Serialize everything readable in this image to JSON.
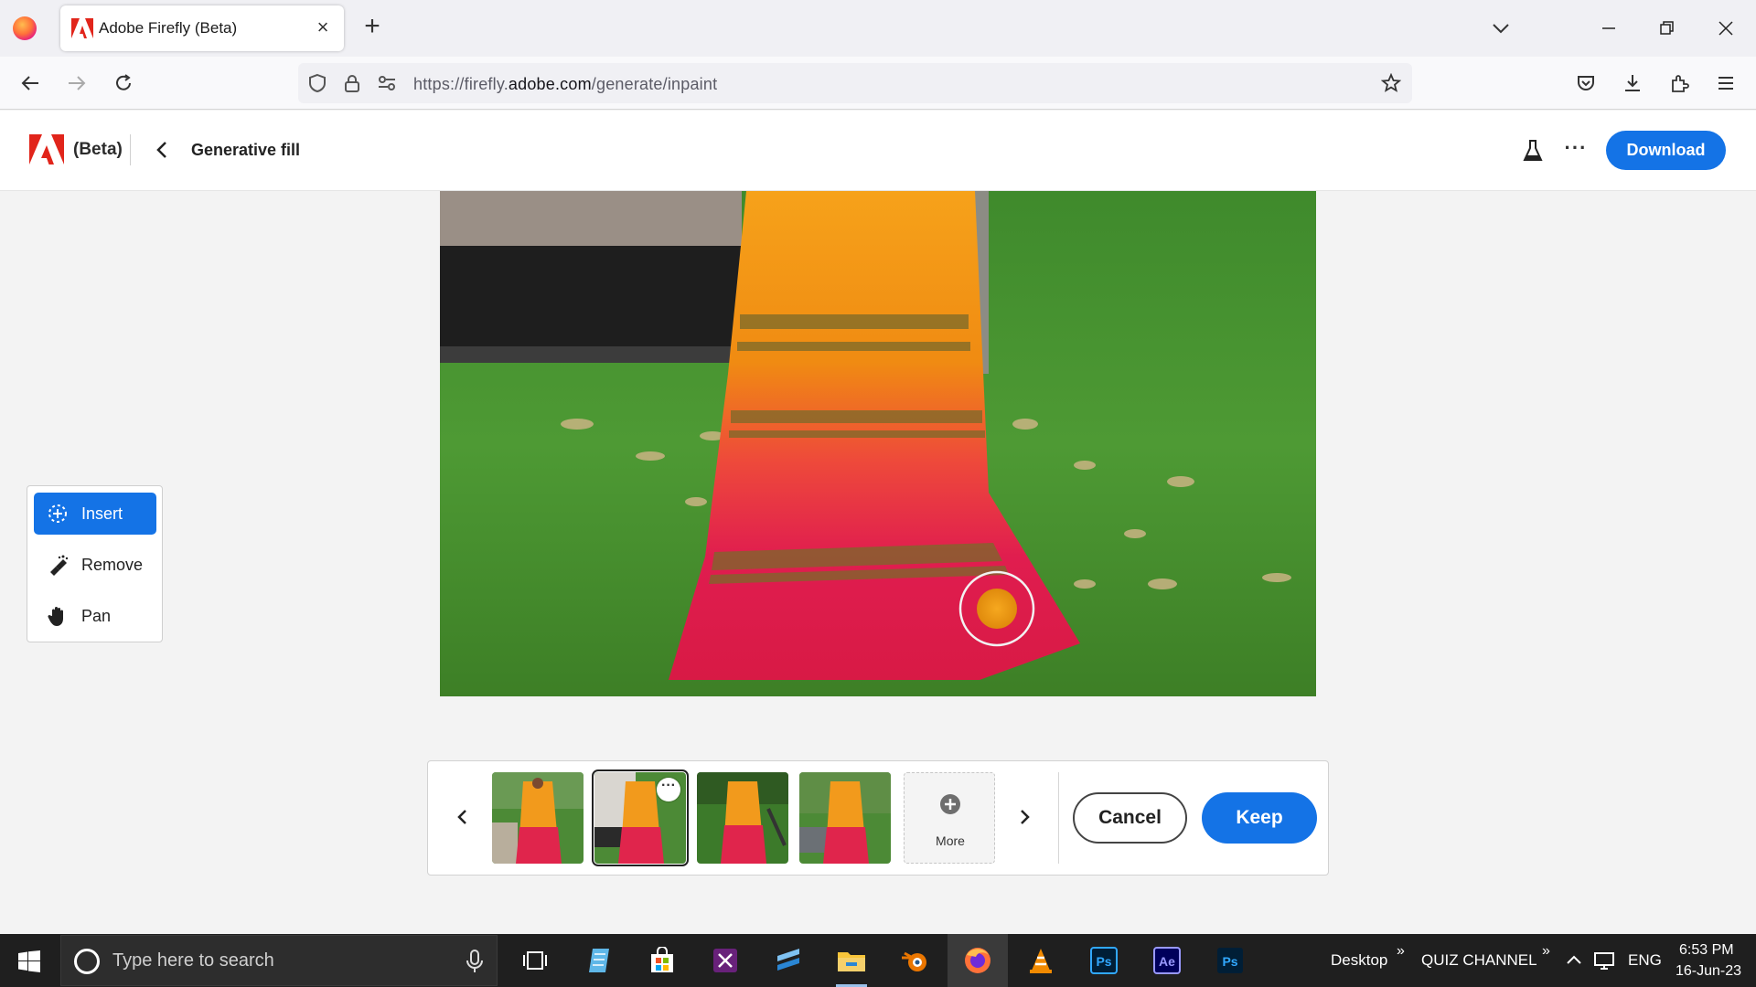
{
  "browser": {
    "tab_title": "Adobe Firefly (Beta)",
    "tab_close": "×",
    "new_tab": "+",
    "url_prefix": "https://firefly.",
    "url_domain": "adobe.com",
    "url_path": "/generate/inpaint"
  },
  "app": {
    "beta_label": "(Beta)",
    "page_title": "Generative fill",
    "more_label": "···",
    "download_label": "Download",
    "accent": "#1473e6"
  },
  "tools": [
    {
      "label": "Insert",
      "icon": "insert-sparkle-icon",
      "active": true
    },
    {
      "label": "Remove",
      "icon": "remove-eraser-icon",
      "active": false
    },
    {
      "label": "Pan",
      "icon": "hand-icon",
      "active": false
    }
  ],
  "variations": {
    "thumbnails": 4,
    "selected_index": 2,
    "thumb_menu": "···",
    "more_label": "More",
    "cancel_label": "Cancel",
    "keep_label": "Keep"
  },
  "taskbar": {
    "search_placeholder": "Type here to search",
    "desktop_label": "Desktop",
    "chevron": "»",
    "quiz_label": "QUIZ CHANNEL",
    "lang": "ENG",
    "time": "6:53 PM",
    "date": "16-Jun-23",
    "ps_label": "Ps",
    "ae_label": "Ae"
  }
}
